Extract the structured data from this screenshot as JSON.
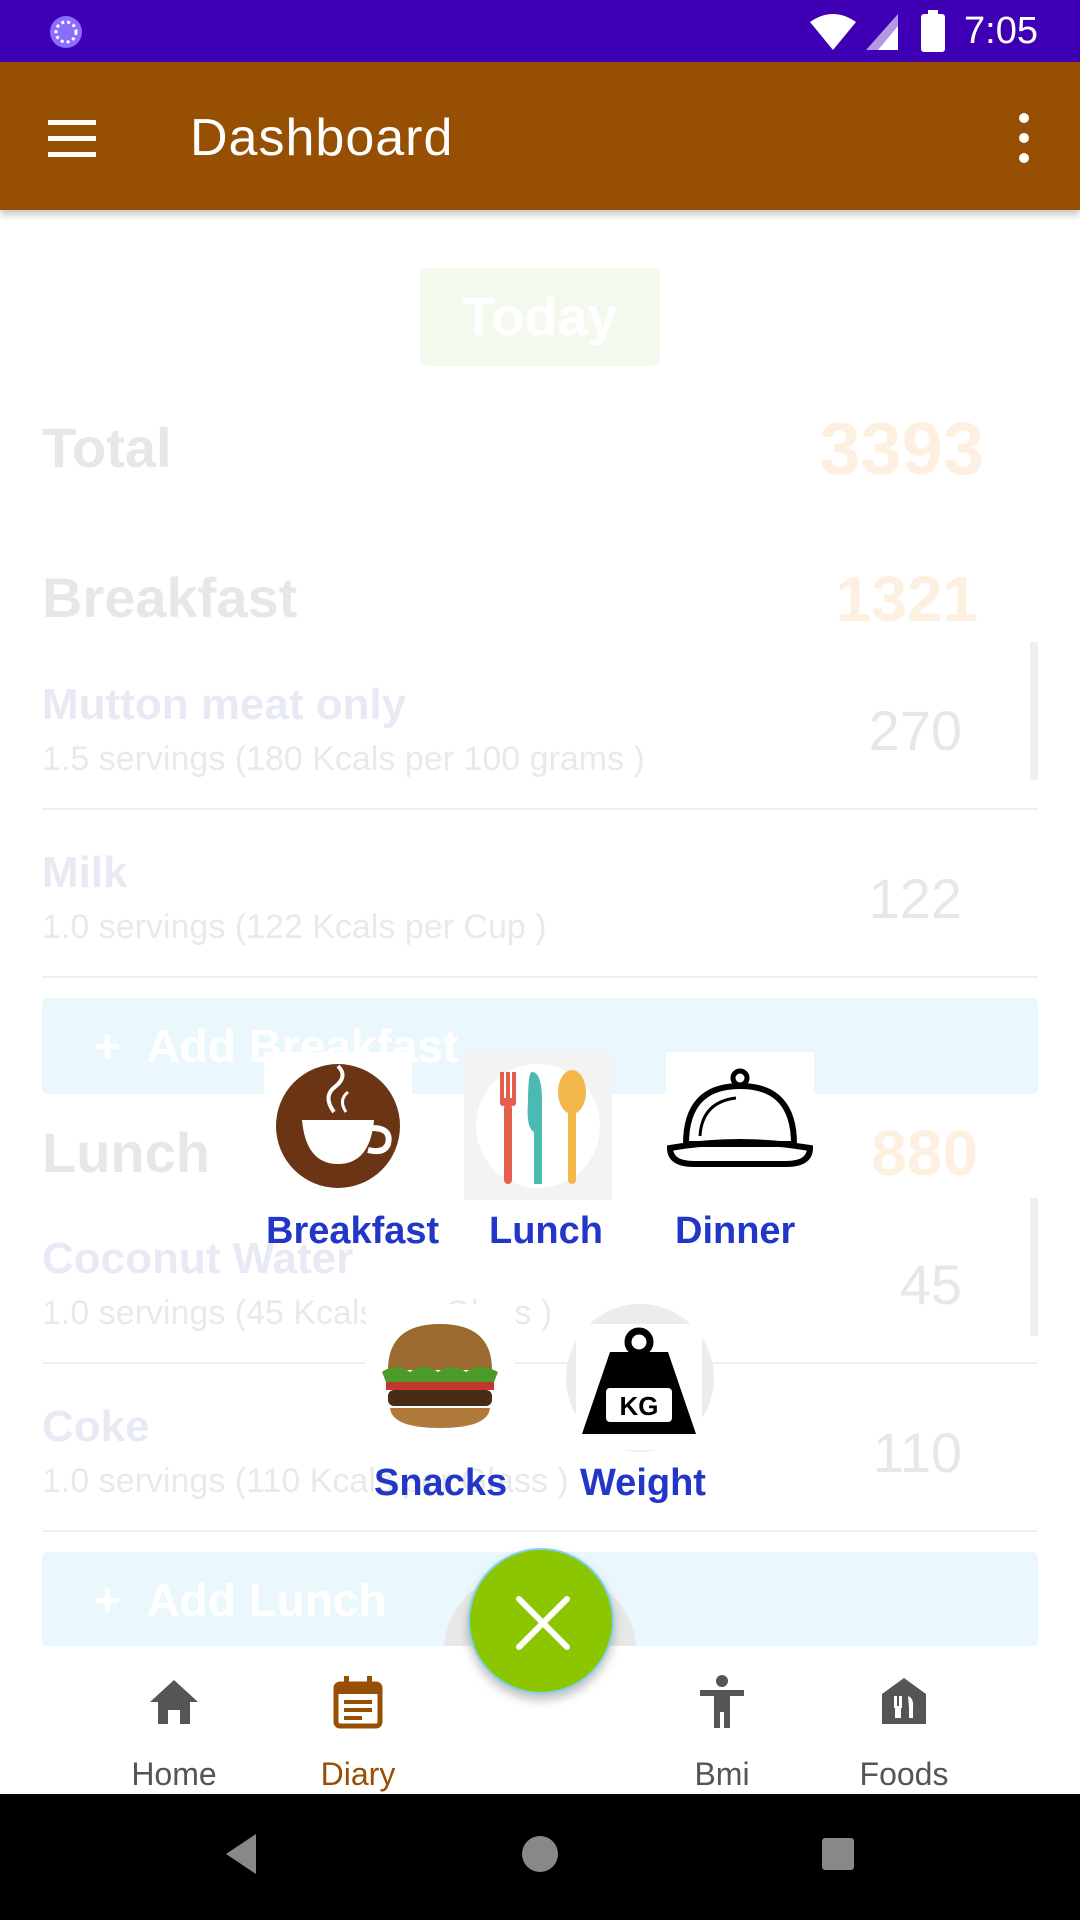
{
  "status_bar": {
    "time": "7:05"
  },
  "app_bar": {
    "title": "Dashboard",
    "menu_icon": "hamburger-menu-icon",
    "more_icon": "more-vert-icon"
  },
  "dashboard": {
    "today_label": "Today",
    "total_label": "Total",
    "total_value": "3393",
    "breakfast": {
      "title": "Breakfast",
      "value": "1321",
      "items": [
        {
          "name": "Mutton meat only",
          "desc": "1.5 servings (180 Kcals per 100 grams )",
          "kcal": "270"
        },
        {
          "name": "Milk",
          "desc": "1.0 servings (122 Kcals per Cup )",
          "kcal": "122"
        }
      ],
      "add_label": "Add Breakfast"
    },
    "lunch": {
      "title": "Lunch",
      "value": "880",
      "items": [
        {
          "name": "Coconut Water",
          "desc": "1.0 servings (45 Kcals per Glass )",
          "kcal": "45"
        },
        {
          "name": "Coke",
          "desc": "1.0 servings (110 Kcals per Glass )",
          "kcal": "110"
        }
      ],
      "add_label": "Add Lunch"
    }
  },
  "picker": {
    "breakfast": "Breakfast",
    "lunch": "Lunch",
    "dinner": "Dinner",
    "snacks": "Snacks",
    "weight": "Weight",
    "weight_badge": "KG"
  },
  "bottom_nav": {
    "home": "Home",
    "diary": "Diary",
    "bmi": "Bmi",
    "foods": "Foods"
  },
  "colors": {
    "status_bar": "#3f00b5",
    "app_bar": "#974f04",
    "accent": "#974f04",
    "fab": "#8bc600",
    "picker_label": "#2236c8"
  }
}
